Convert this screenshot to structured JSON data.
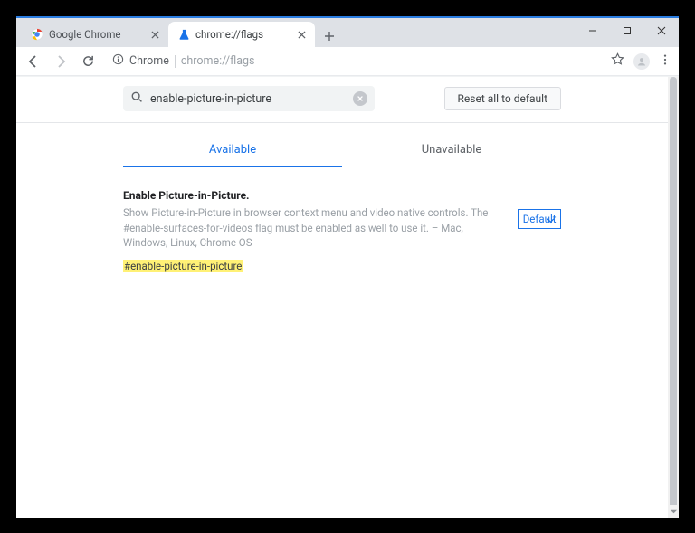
{
  "window": {
    "tabs": [
      {
        "title": "Google Chrome",
        "favicon": "chrome-icon",
        "active": false
      },
      {
        "title": "chrome://flags",
        "favicon": "flask-icon",
        "active": true
      }
    ]
  },
  "toolbar": {
    "origin_chip": "Chrome",
    "url_path": "chrome://flags"
  },
  "flags_page": {
    "search_value": "enable-picture-in-picture",
    "reset_button": "Reset all to default",
    "tabs": {
      "available": "Available",
      "unavailable": "Unavailable",
      "active": "available"
    },
    "results": [
      {
        "title": "Enable Picture-in-Picture.",
        "description": "Show Picture-in-Picture in browser context menu and video native controls. The #enable-surfaces-for-videos flag must be enabled as well to use it. – Mac, Windows, Linux, Chrome OS",
        "hash_link": "#enable-picture-in-picture",
        "select_value": "Default"
      }
    ]
  }
}
